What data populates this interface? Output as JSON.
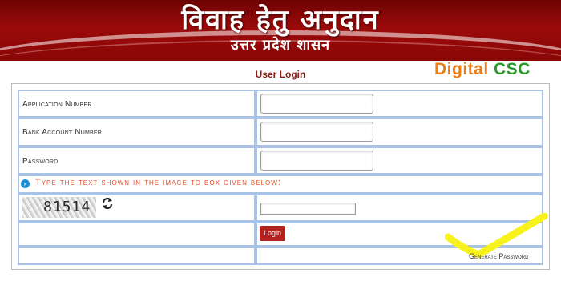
{
  "banner": {
    "title": "विवाह हेतु अनुदान",
    "subtitle": "उत्तर प्रदेश शासन"
  },
  "brand": {
    "part1": "Digital",
    "part2": "CSC"
  },
  "page": {
    "heading": "User Login"
  },
  "form": {
    "application_number_label": "Application Number",
    "application_number_value": "",
    "bank_account_label": "Bank Account Number",
    "bank_account_value": "",
    "password_label": "Password",
    "password_value": "",
    "captcha_hint": "Type the text shown in the image to box given below:",
    "captcha_text": "81514",
    "captcha_value": "",
    "login_label": "Login",
    "generate_password_label": "Generate Password"
  },
  "colors": {
    "banner": "#8a0707",
    "heading": "#8a1b12",
    "cell_border": "#a9c3e6",
    "button": "#b3221e",
    "hint": "#e0542d",
    "annotation": "#f7f21c"
  }
}
